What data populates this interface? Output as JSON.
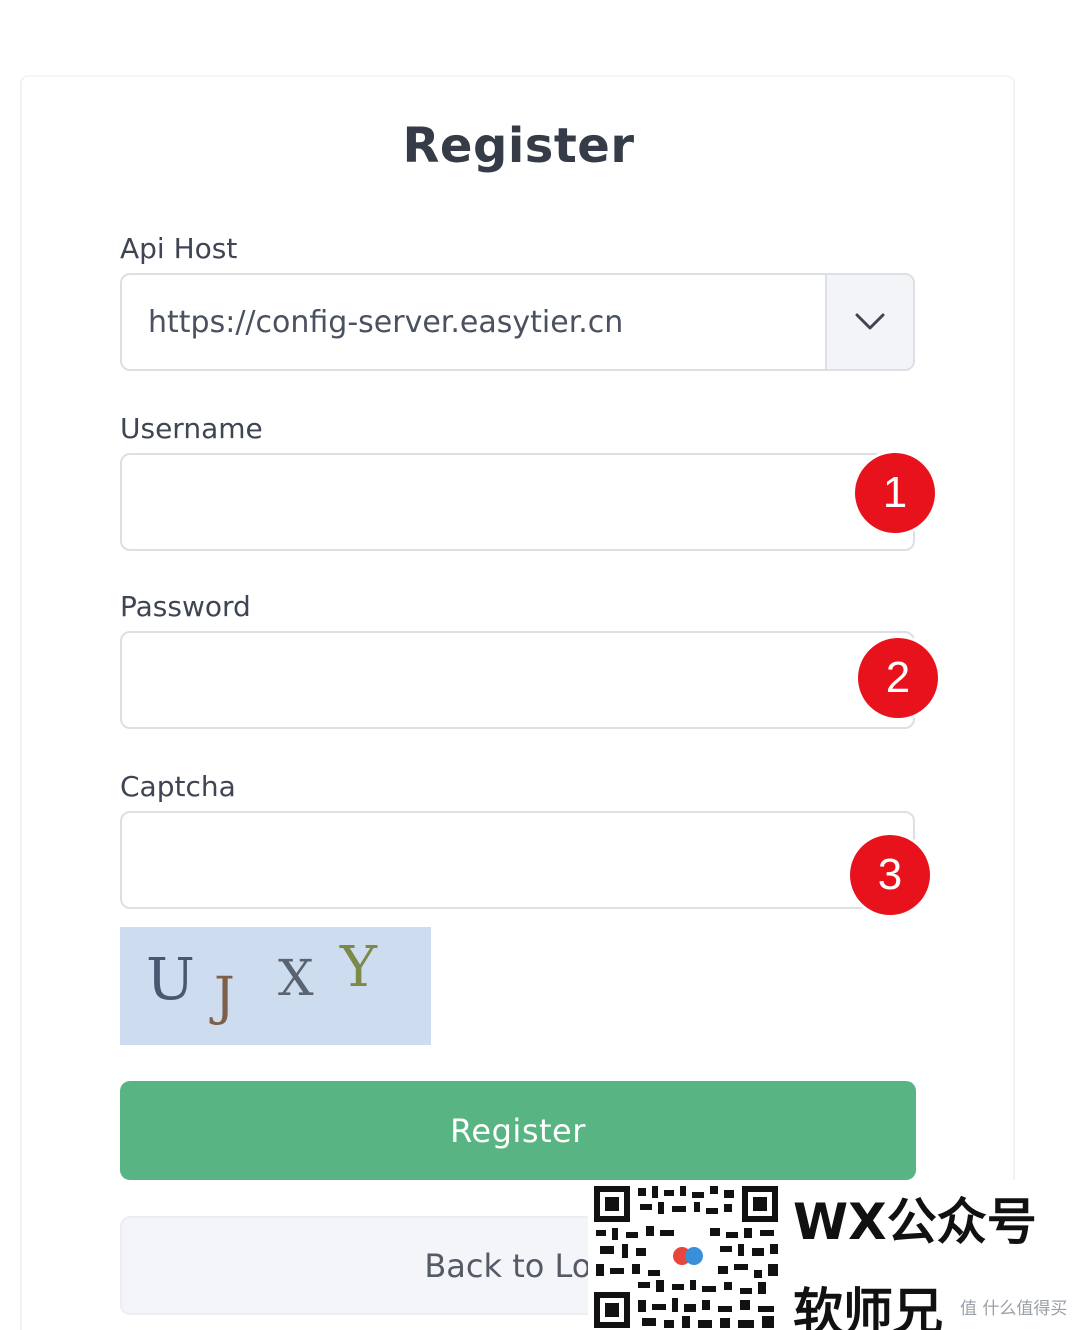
{
  "form": {
    "title": "Register",
    "api_host": {
      "label": "Api Host",
      "value": "https://config-server.easytier.cn"
    },
    "username": {
      "label": "Username",
      "value": ""
    },
    "password": {
      "label": "Password",
      "value": ""
    },
    "captcha": {
      "label": "Captcha",
      "value": "",
      "image_text": [
        "U",
        "J",
        "X",
        "Y"
      ]
    },
    "register_button": "Register",
    "back_button": "Back to Log"
  },
  "annotations": [
    "1",
    "2",
    "3"
  ],
  "watermark": {
    "line1": "WX公众号",
    "line2": "软师兄",
    "site": "值 什么值得买"
  },
  "colors": {
    "accent_green": "#58b583",
    "badge_red": "#e8121c",
    "captcha_bg": "#cddcee"
  }
}
